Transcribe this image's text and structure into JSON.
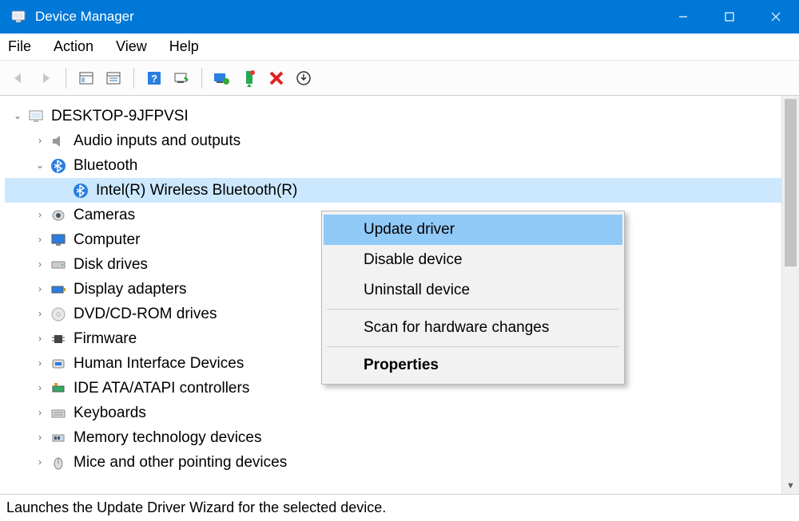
{
  "window": {
    "title": "Device Manager"
  },
  "menu": {
    "items": [
      "File",
      "Action",
      "View",
      "Help"
    ]
  },
  "toolbar": {
    "buttons": [
      "back",
      "forward",
      "show-hidden",
      "properties-sheet",
      "help",
      "scan",
      "update-driver",
      "disable",
      "uninstall",
      "show-all"
    ]
  },
  "tree": {
    "root": "DESKTOP-9JFPVSI",
    "nodes": [
      {
        "label": "Audio inputs and outputs",
        "icon": "speaker",
        "expanded": false
      },
      {
        "label": "Bluetooth",
        "icon": "bluetooth",
        "expanded": true,
        "children": [
          {
            "label": "Intel(R) Wireless Bluetooth(R)",
            "icon": "bluetooth",
            "selected": true
          }
        ]
      },
      {
        "label": "Cameras",
        "icon": "camera",
        "expanded": false
      },
      {
        "label": "Computer",
        "icon": "monitor",
        "expanded": false
      },
      {
        "label": "Disk drives",
        "icon": "disk",
        "expanded": false
      },
      {
        "label": "Display adapters",
        "icon": "display-adapter",
        "expanded": false
      },
      {
        "label": "DVD/CD-ROM drives",
        "icon": "disc",
        "expanded": false
      },
      {
        "label": "Firmware",
        "icon": "chip",
        "expanded": false
      },
      {
        "label": "Human Interface Devices",
        "icon": "hid",
        "expanded": false
      },
      {
        "label": "IDE ATA/ATAPI controllers",
        "icon": "controller",
        "expanded": false
      },
      {
        "label": "Keyboards",
        "icon": "keyboard",
        "expanded": false
      },
      {
        "label": "Memory technology devices",
        "icon": "memory",
        "expanded": false
      },
      {
        "label": "Mice and other pointing devices",
        "icon": "mouse",
        "expanded": false
      }
    ]
  },
  "context_menu": {
    "items": [
      {
        "label": "Update driver",
        "highlight": true
      },
      {
        "label": "Disable device"
      },
      {
        "label": "Uninstall device"
      },
      {
        "sep": true
      },
      {
        "label": "Scan for hardware changes"
      },
      {
        "sep": true
      },
      {
        "label": "Properties",
        "bold": true
      }
    ]
  },
  "statusbar": {
    "text": "Launches the Update Driver Wizard for the selected device."
  },
  "colors": {
    "accent": "#0078d7",
    "selection": "#cce8ff",
    "menu_highlight": "#91c9f7"
  }
}
